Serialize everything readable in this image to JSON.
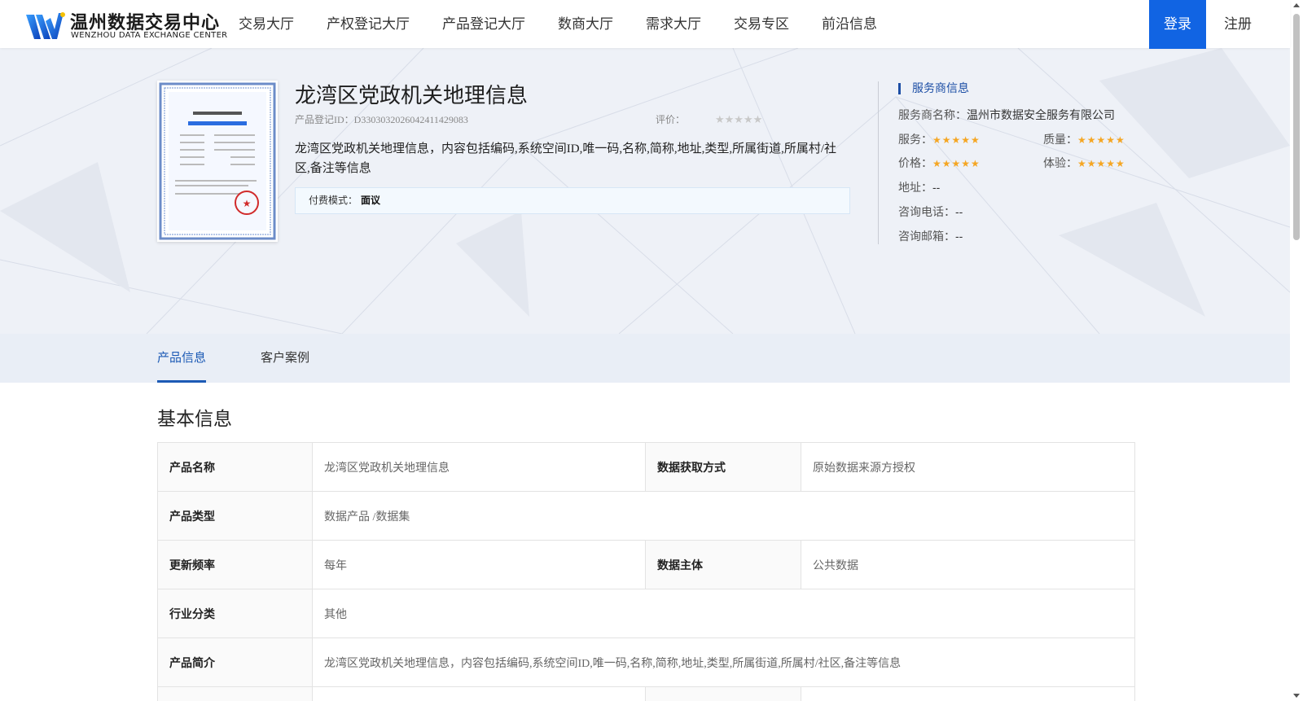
{
  "brand": {
    "name_cn": "温州数据交易中心",
    "name_en": "WENZHOU DATA EXCHANGE CENTER",
    "accent": "#1164e3"
  },
  "nav": {
    "items": [
      {
        "label": "交易大厅"
      },
      {
        "label": "产权登记大厅"
      },
      {
        "label": "产品登记大厅"
      },
      {
        "label": "数商大厅"
      },
      {
        "label": "需求大厅"
      },
      {
        "label": "交易专区"
      },
      {
        "label": "前沿信息"
      }
    ],
    "login": "登录",
    "register": "注册"
  },
  "product": {
    "title": "龙湾区党政机关地理信息",
    "id_label": "产品登记ID：",
    "id": "D3303032026042411429083",
    "rating_label": "评价：",
    "rating_stars": "★★★★★",
    "rating_value": 0,
    "description": "龙湾区党政机关地理信息，内容包括编码,系统空间ID,唯一码,名称,简称,地址,类型,所属街道,所属村/社区,备注等信息",
    "fee_label": "付费模式：",
    "fee_value": "面议"
  },
  "provider": {
    "section_title": "服务商信息",
    "name_label": "服务商名称：",
    "name": "温州市数据安全服务有限公司",
    "service_label": "服务：",
    "quality_label": "质量：",
    "price_label": "价格：",
    "experience_label": "体验：",
    "stars": "★★★★★",
    "service_rating": 5,
    "quality_rating": 5,
    "price_rating": 5,
    "experience_rating": 5,
    "address_label": "地址：",
    "address": "--",
    "phone_label": "咨询电话：",
    "phone": "--",
    "email_label": "咨询邮箱：",
    "email": "--"
  },
  "tabs": [
    {
      "label": "产品信息",
      "active": true
    },
    {
      "label": "客户案例",
      "active": false
    }
  ],
  "basic_info": {
    "title": "基本信息",
    "rows": [
      {
        "k1": "产品名称",
        "v1": "龙湾区党政机关地理信息",
        "k2": "数据获取方式",
        "v2": "原始数据来源方授权"
      },
      {
        "k1": "产品类型",
        "v1": "数据产品 /数据集"
      },
      {
        "k1": "更新频率",
        "v1": "每年",
        "k2": "数据主体",
        "v2": "公共数据"
      },
      {
        "k1": "行业分类",
        "v1": "其他"
      },
      {
        "k1": "产品简介",
        "v1": "龙湾区党政机关地理信息，内容包括编码,系统空间ID,唯一码,名称,简称,地址,类型,所属街道,所属村/社区,备注等信息"
      }
    ]
  }
}
